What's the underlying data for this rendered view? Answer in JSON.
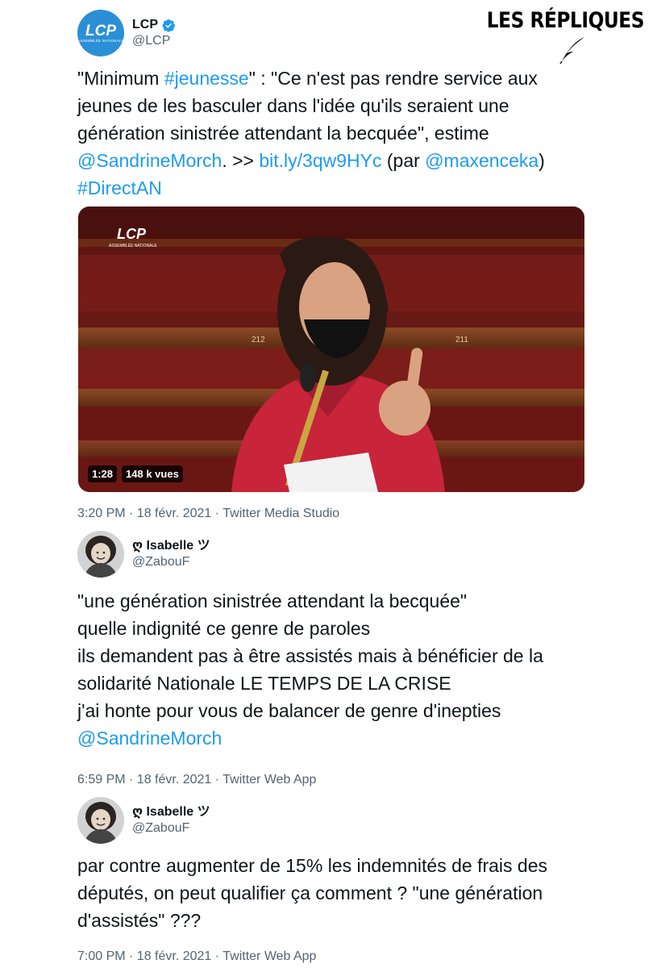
{
  "brand": {
    "title": "LES RÉPLIQUES"
  },
  "tweets": [
    {
      "name": "LCP",
      "handle": "@LCP",
      "avatar": {
        "text": "LCP",
        "subtext": "ASSEMBLÉE NATIONALE"
      },
      "lines": [
        [
          {
            "t": "\"Minimum ",
            "link": false
          },
          {
            "t": "#jeunesse",
            "link": true
          },
          {
            "t": "\" : \"Ce n'est pas rendre service aux",
            "link": false
          }
        ],
        [
          {
            "t": "jeunes de les basculer dans l'idée qu'ils seraient une",
            "link": false
          }
        ],
        [
          {
            "t": "génération sinistrée attendant la becquée\", estime",
            "link": false
          }
        ],
        [
          {
            "t": "@SandrineMorch",
            "link": true
          },
          {
            "t": ". >> ",
            "link": false
          },
          {
            "t": "bit.ly/3qw9HYc",
            "link": true
          },
          {
            "t": " (par ",
            "link": false
          },
          {
            "t": "@maxenceka",
            "link": true
          },
          {
            "t": ")",
            "link": false
          }
        ],
        [
          {
            "t": "#DirectAN",
            "link": true
          }
        ]
      ],
      "video": {
        "duration": "1:28",
        "views": "148 k vues",
        "channel_logo": "LCP",
        "channel_sub": "ASSEMBLÉE NATIONALE",
        "seat_left": "212",
        "seat_right": "211"
      },
      "meta": "3:20 PM · 18 févr. 2021 · Twitter Media Studio"
    },
    {
      "name": "ღ Isabelle ツ",
      "handle": "@ZabouF",
      "lines": [
        [
          {
            "t": "\"une génération sinistrée attendant la becquée\"",
            "link": false
          }
        ],
        [
          {
            "t": "quelle indignité ce genre de paroles",
            "link": false
          }
        ],
        [
          {
            "t": "ils demandent pas à être assistés mais à bénéficier de la",
            "link": false
          }
        ],
        [
          {
            "t": "solidarité Nationale LE TEMPS DE LA CRISE",
            "link": false
          }
        ],
        [
          {
            "t": "j'ai honte pour vous de balancer de genre d'inepties",
            "link": false
          }
        ],
        [
          {
            "t": "@SandrineMorch",
            "link": true
          }
        ]
      ],
      "meta": "6:59 PM · 18 févr. 2021 · Twitter Web App"
    },
    {
      "name": "ღ Isabelle ツ",
      "handle": "@ZabouF",
      "lines": [
        [
          {
            "t": "par contre augmenter de 15% les indemnités de frais des",
            "link": false
          }
        ],
        [
          {
            "t": "députés, on peut qualifier ça comment ? \"une génération",
            "link": false
          }
        ],
        [
          {
            "t": "d'assistés\" ???",
            "link": false
          }
        ]
      ],
      "meta": "7:00 PM · 18 févr. 2021 · Twitter Web App"
    }
  ],
  "colors": {
    "link": "#1d9bf0",
    "meta": "#536471",
    "verified": "#1d9bf0",
    "lcp_blue": "#2a8fd6"
  }
}
